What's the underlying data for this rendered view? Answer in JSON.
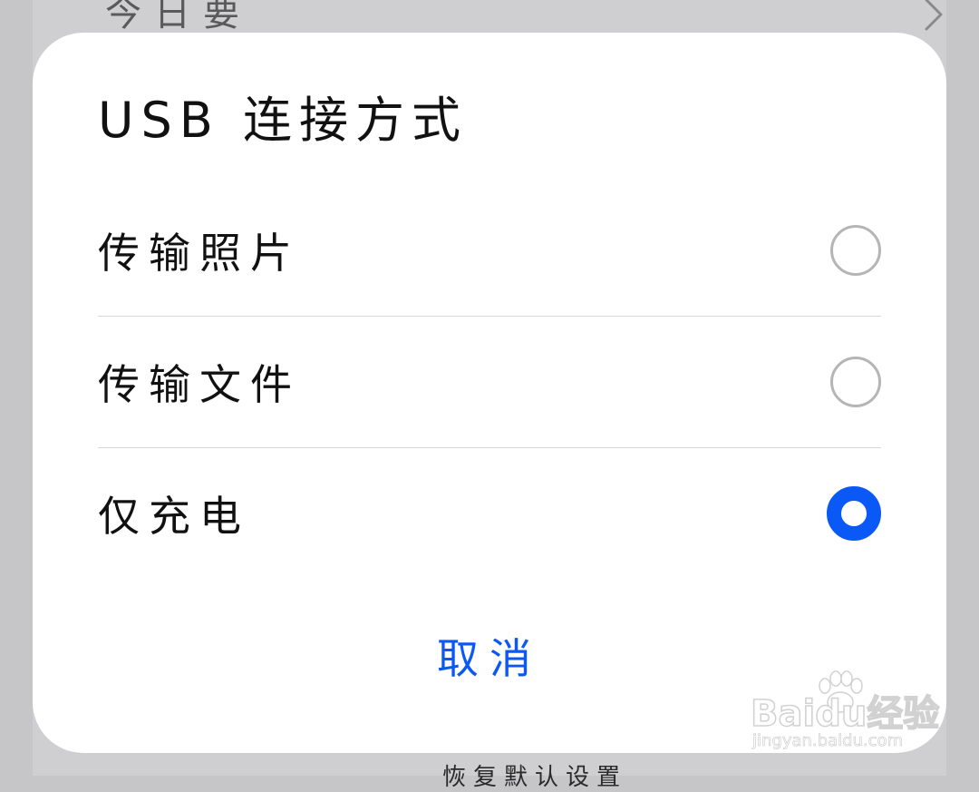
{
  "background": {
    "top_text": "今日要",
    "bottom_text": "恢复默认设置"
  },
  "dialog": {
    "title": "USB 连接方式",
    "options": [
      {
        "label": "传输照片",
        "selected": false
      },
      {
        "label": "传输文件",
        "selected": false
      },
      {
        "label": "仅充电",
        "selected": true
      }
    ],
    "cancel_label": "取消"
  },
  "watermark": {
    "logo_text": "Baidu经验",
    "url": "jingyan.baidu.com"
  },
  "colors": {
    "accent": "#0a59f7",
    "dialog_bg": "#ffffff",
    "scrim": "#c6c6c8",
    "radio_unchecked": "#b5b5b5",
    "divider": "#d8d8d8"
  },
  "icons": {
    "chevron": "chevron-right-icon",
    "paw": "paw-icon"
  }
}
